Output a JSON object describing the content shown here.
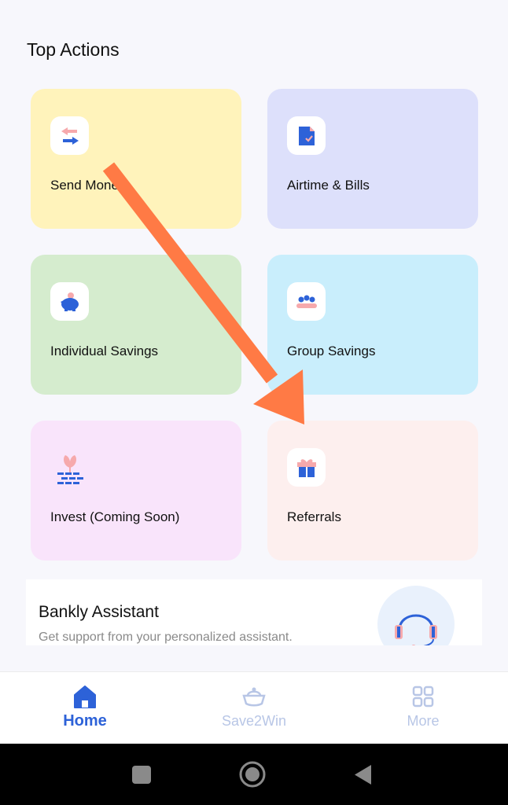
{
  "section_title": "Top Actions",
  "actions": [
    {
      "label": "Send Money",
      "icon": "transfer-arrows-icon"
    },
    {
      "label": "Airtime & Bills",
      "icon": "bill-document-icon"
    },
    {
      "label": "Individual Savings",
      "icon": "piggy-bank-icon"
    },
    {
      "label": "Group Savings",
      "icon": "group-people-icon"
    },
    {
      "label": "Invest (Coming Soon)",
      "icon": "sprout-bricks-icon"
    },
    {
      "label": "Referrals",
      "icon": "gift-box-icon"
    }
  ],
  "assistant": {
    "title": "Bankly Assistant",
    "subtitle": "Get support from your personalized assistant.",
    "icon": "headset-icon"
  },
  "bottom_nav": [
    {
      "label": "Home",
      "icon": "home-icon",
      "active": true
    },
    {
      "label": "Save2Win",
      "icon": "save2win-icon",
      "active": false
    },
    {
      "label": "More",
      "icon": "grid-icon",
      "active": false
    }
  ],
  "system_nav": [
    "recents-button",
    "home-button",
    "back-button"
  ],
  "colors": {
    "accent_blue": "#2d62d8",
    "inactive_nav": "#b8c6e6",
    "annotation_arrow": "#ff7a45"
  }
}
